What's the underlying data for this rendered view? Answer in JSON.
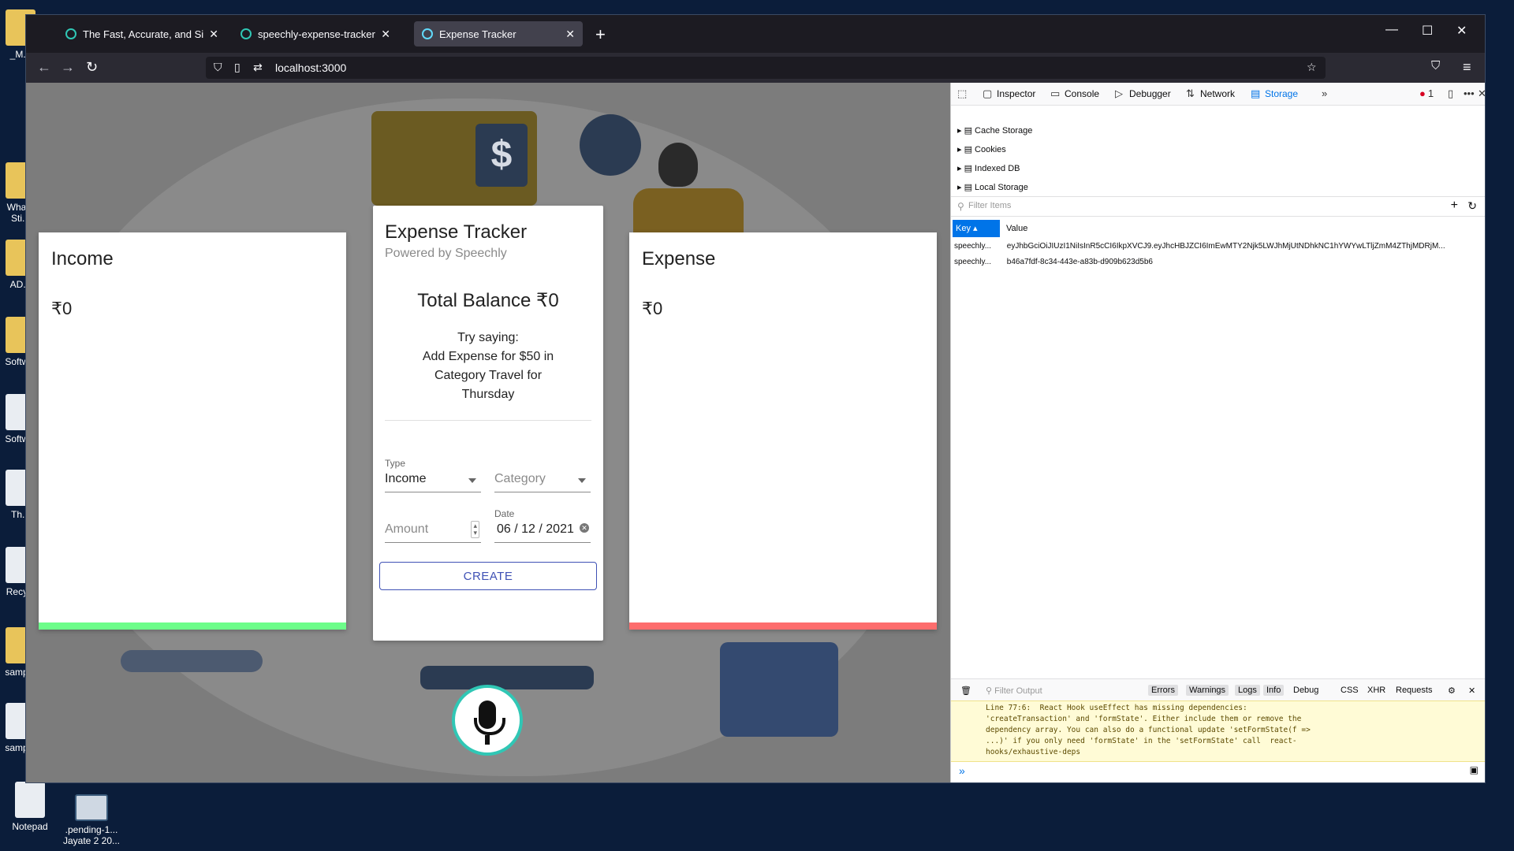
{
  "desktop": {
    "icons": [
      {
        "label": "_M..."
      },
      {
        "label": "Wha... Sti..."
      },
      {
        "label": "AD..."
      },
      {
        "label": "Softw..."
      },
      {
        "label": "Softw..."
      },
      {
        "label": "Th..."
      },
      {
        "label": "Recy..."
      },
      {
        "label": "samp..."
      },
      {
        "label": "samp..."
      },
      {
        "label": "Notepad"
      },
      {
        "label": ".pending-1... Jayate 2 20..."
      }
    ]
  },
  "browser": {
    "tabs": [
      {
        "title": "The Fast, Accurate, and Simple V",
        "icon": "speechly-icon"
      },
      {
        "title": "speechly-expense-tracker - Spe",
        "icon": "speechly-icon"
      },
      {
        "title": "Expense Tracker",
        "icon": "react-icon"
      }
    ],
    "url": "localhost:3000"
  },
  "app": {
    "income": {
      "title": "Income",
      "amount": "₹0",
      "accent": "#6dfd8a"
    },
    "expense": {
      "title": "Expense",
      "amount": "₹0",
      "accent": "#fd6d6d"
    },
    "main": {
      "title": "Expense Tracker",
      "subtitle": "Powered by Speechly",
      "balance": "Total Balance ₹0",
      "hint_1": "Try saying:",
      "hint_2": "Add Expense for $50 in",
      "hint_3": "Category Travel for",
      "hint_4": "Thursday",
      "form": {
        "type_label": "Type",
        "type_value": "Income",
        "category_placeholder": "Category",
        "amount_placeholder": "Amount",
        "date_label": "Date",
        "date_value": "06 / 12 / 2021",
        "create_label": "CREATE"
      }
    },
    "mic_color": "#30c7b5"
  },
  "devtools": {
    "tabs": [
      "Inspector",
      "Console",
      "Debugger",
      "Network",
      "Storage"
    ],
    "error_count": "1",
    "storage_tree": [
      "Cache Storage",
      "Cookies",
      "Indexed DB",
      "Local Storage"
    ],
    "filter_placeholder": "Filter Items",
    "columns": [
      "Key",
      "Value"
    ],
    "rows": [
      {
        "key": "speechly...",
        "value": "eyJhbGciOiJIUzI1NiIsInR5cCI6IkpXVCJ9.eyJhcHBJZCI6ImEwMTY2Njk5LWJhMjUtNDhkNC1hYWYwLTljZmM4ZThjMDRjM..."
      },
      {
        "key": "speechly...",
        "value": "b46a7fdf-8c34-443e-a83b-d909b623d5b6"
      }
    ],
    "console": {
      "filter_placeholder": "Filter Output",
      "levels": [
        "Errors",
        "Warnings",
        "Logs",
        "Info",
        "Debug"
      ],
      "types": [
        "CSS",
        "XHR",
        "Requests"
      ],
      "warning": "Line 77:6:  React Hook useEffect has missing dependencies:\n'createTransaction' and 'formState'. Either include them or remove the\ndependency array. You can also do a functional update 'setFormState(f =>\n...)' if you only need 'formState' in the 'setFormState' call  react-\nhooks/exhaustive-deps",
      "prompt": "»"
    }
  }
}
